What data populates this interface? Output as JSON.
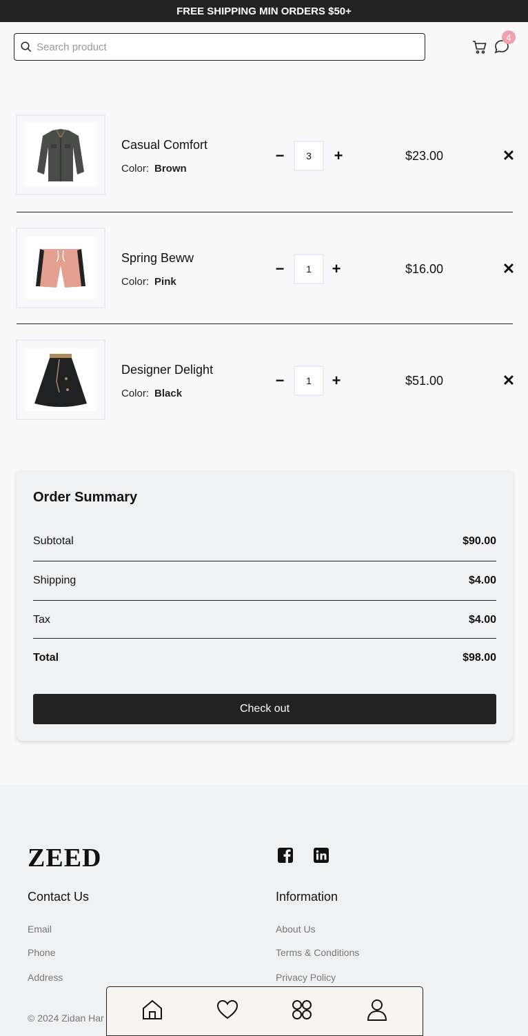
{
  "topbar": {
    "text": "FREE SHIPPING MIN ORDERS $50+"
  },
  "header": {
    "search_placeholder": "Search product",
    "chat_badge": "4"
  },
  "cart": {
    "items": [
      {
        "name": "Casual Comfort",
        "color_label": "Color:",
        "color": "Brown",
        "qty": "3",
        "price": "$23.00",
        "image": "jacket-image"
      },
      {
        "name": "Spring Beww",
        "color_label": "Color:",
        "color": "Pink",
        "qty": "1",
        "price": "$16.00",
        "image": "shorts-image"
      },
      {
        "name": "Designer Delight",
        "color_label": "Color:",
        "color": "Black",
        "qty": "1",
        "price": "$51.00",
        "image": "skirt-image"
      }
    ]
  },
  "summary": {
    "title": "Order Summary",
    "subtotal_label": "Subtotal",
    "subtotal": "$90.00",
    "shipping_label": "Shipping",
    "shipping": "$4.00",
    "tax_label": "Tax",
    "tax": "$4.00",
    "total_label": "Total",
    "total": "$98.00",
    "checkout_label": "Check out"
  },
  "footer": {
    "logo": "ZEED",
    "contact_heading": "Contact Us",
    "contact_links": [
      "Email",
      "Phone",
      "Address"
    ],
    "info_heading": "Information",
    "info_links": [
      "About Us",
      "Terms & Conditions",
      "Privacy Policy"
    ],
    "copyright": "© 2024 Zidan Har"
  },
  "bottom_nav": [
    "home-icon",
    "heart-icon",
    "grid-icon",
    "user-icon"
  ]
}
